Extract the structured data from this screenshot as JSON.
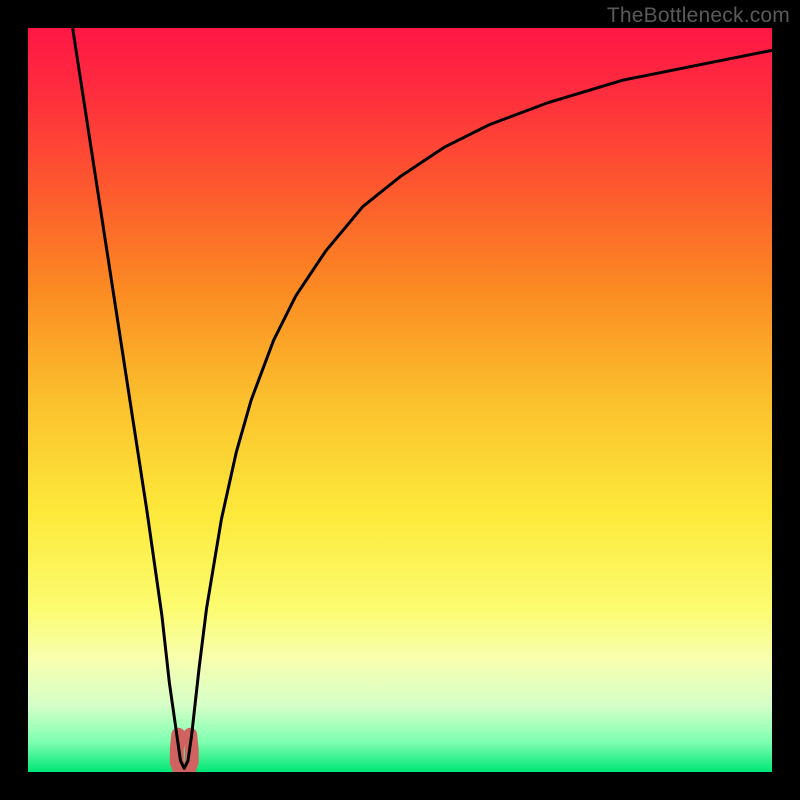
{
  "watermark": "TheBottleneck.com",
  "chart_data": {
    "type": "line",
    "title": "",
    "xlabel": "",
    "ylabel": "",
    "xlim": [
      0,
      100
    ],
    "ylim": [
      0,
      100
    ],
    "gradient_stops": [
      {
        "offset": 0.0,
        "color": "#ff1744"
      },
      {
        "offset": 0.08,
        "color": "#ff2b3f"
      },
      {
        "offset": 0.2,
        "color": "#fd5330"
      },
      {
        "offset": 0.35,
        "color": "#fb8a22"
      },
      {
        "offset": 0.5,
        "color": "#fbc02d"
      },
      {
        "offset": 0.65,
        "color": "#fde93a"
      },
      {
        "offset": 0.78,
        "color": "#fcfc70"
      },
      {
        "offset": 0.85,
        "color": "#f7ffb0"
      },
      {
        "offset": 0.91,
        "color": "#d6ffc8"
      },
      {
        "offset": 0.96,
        "color": "#7dffb0"
      },
      {
        "offset": 1.0,
        "color": "#00e676"
      }
    ],
    "series": [
      {
        "name": "bottleneck-curve",
        "color": "#000000",
        "width": 3,
        "x": [
          6,
          8,
          10,
          12,
          14,
          16,
          18,
          19,
          20,
          20.5,
          21,
          21.5,
          22,
          23,
          24,
          26,
          28,
          30,
          33,
          36,
          40,
          45,
          50,
          56,
          62,
          70,
          80,
          90,
          100
        ],
        "y": [
          100,
          87,
          74,
          61,
          48,
          35,
          21,
          12,
          5,
          1.5,
          0.5,
          1.5,
          5,
          14,
          22,
          34,
          43,
          50,
          58,
          64,
          70,
          76,
          80,
          84,
          87,
          90,
          93,
          95,
          97
        ]
      },
      {
        "name": "optimal-marker",
        "color": "#d0635f",
        "width": 14,
        "linecap": "round",
        "x": [
          20.2,
          20.0,
          20.0,
          20.3,
          21.0,
          21.7,
          22.0,
          22.0,
          21.8
        ],
        "y": [
          5.0,
          3.0,
          1.3,
          0.5,
          0.3,
          0.5,
          1.3,
          3.0,
          5.0
        ]
      }
    ]
  }
}
